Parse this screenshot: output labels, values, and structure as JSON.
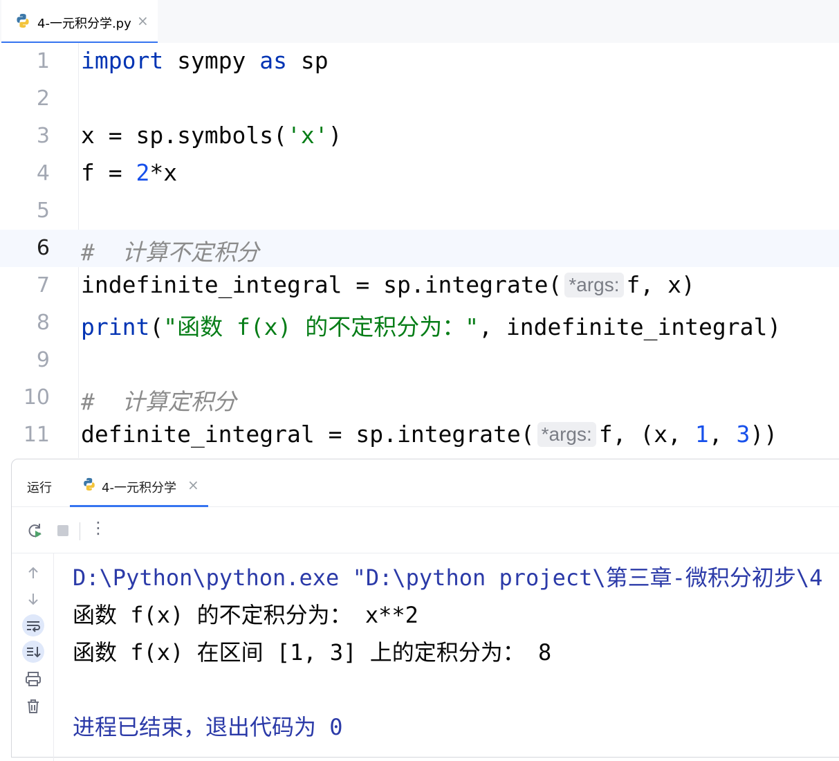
{
  "editor_tab": {
    "title": "4-一元积分学.py",
    "close": "×"
  },
  "editor": {
    "line_numbers": [
      "1",
      "2",
      "3",
      "4",
      "5",
      "6",
      "7",
      "8",
      "9",
      "10",
      "11"
    ],
    "current_line": 6,
    "lines": {
      "l1": {
        "kw1": "import",
        "t1": " sympy ",
        "kw2": "as",
        "t2": " sp"
      },
      "l3": {
        "t1": "x = sp.symbols(",
        "s1": "'x'",
        "t2": ")"
      },
      "l4": {
        "t1": "f = ",
        "n1": "2",
        "t2": "*x"
      },
      "l6": {
        "c": "#  计算不定积分"
      },
      "l7": {
        "t1": "indefinite_integral = sp.integrate(",
        "hint": "*args:",
        "t2": "f, x)"
      },
      "l8": {
        "kw1": "print",
        "t1": "(",
        "s1": "\"函数 f(x) 的不定积分为：\"",
        "t2": ", indefinite_integral)"
      },
      "l10": {
        "c": "#  计算定积分"
      },
      "l11": {
        "t1": "definite_integral = sp.integrate(",
        "hint": "*args:",
        "t2": "f, (x, ",
        "n1": "1",
        "t3": ", ",
        "n2": "3",
        "t4": "))"
      }
    }
  },
  "run_window": {
    "title": "运行",
    "tab": {
      "label": "4-一元积分学",
      "close": "×"
    },
    "toolbar": {
      "rerun": "rerun-icon",
      "stop": "stop-icon",
      "more": "⋮"
    },
    "sidebar_icons": [
      "arrow-up-icon",
      "arrow-down-icon",
      "soft-wrap-icon",
      "scroll-to-end-icon",
      "print-icon",
      "trash-icon"
    ],
    "console": [
      "D:\\Python\\python.exe \"D:\\python project\\第三章-微积分初步\\4",
      "函数 f(x) 的不定积分为： x**2",
      "函数 f(x) 在区间 [1, 3] 上的定积分为： 8",
      "",
      "进程已结束，退出代码为 0"
    ]
  },
  "colors": {
    "accent": "#3574f0",
    "keyword": "#0033b3",
    "string": "#067d17",
    "number": "#1750eb",
    "comment": "#8c8c8c"
  }
}
